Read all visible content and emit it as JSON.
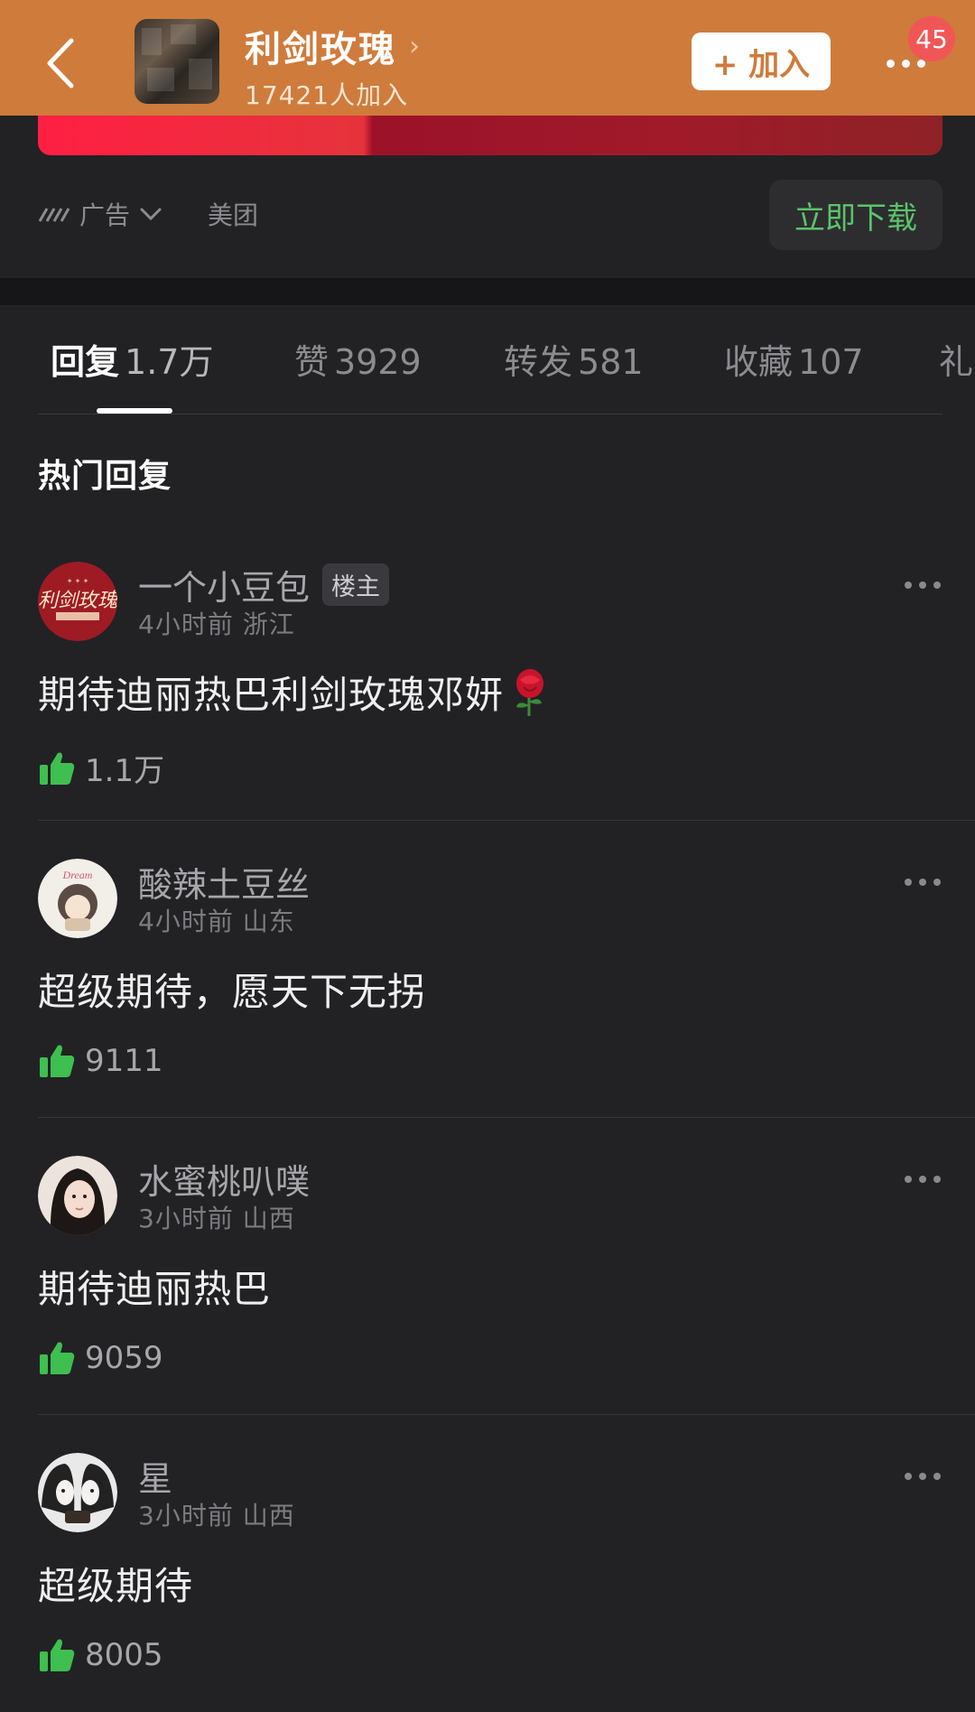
{
  "header": {
    "group_name": "利剑玫瑰",
    "member_count": "17421人加入",
    "join_label": "+ 加入",
    "notification_badge": "45",
    "bg_color": "#cf7b3b"
  },
  "ad": {
    "tag_label": "广告",
    "advertiser": "美团",
    "download_label": "立即下载"
  },
  "tabs": [
    {
      "label": "回复",
      "count": "1.7万",
      "active": true
    },
    {
      "label": "赞",
      "count": "3929"
    },
    {
      "label": "转发",
      "count": "581"
    },
    {
      "label": "收藏",
      "count": "107"
    },
    {
      "label": "礼",
      "count": ""
    }
  ],
  "section_title": "热门回复",
  "comments": [
    {
      "name": "一个小豆包",
      "tag": "楼主",
      "time": "4小时前",
      "location": "浙江",
      "content": "期待迪丽热巴利剑玫瑰邓妍",
      "emoji": "rose-icon",
      "likes": "1.1万"
    },
    {
      "name": "酸辣土豆丝",
      "time": "4小时前",
      "location": "山东",
      "content": "超级期待，愿天下无拐",
      "likes": "9111"
    },
    {
      "name": "水蜜桃叭噗",
      "time": "3小时前",
      "location": "山西",
      "content": "期待迪丽热巴",
      "likes": "9059"
    },
    {
      "name": "星",
      "time": "3小时前",
      "location": "山西",
      "content": "超级期待",
      "likes": "8005"
    }
  ],
  "colors": {
    "like_green": "#3fbf4f",
    "download_green": "#5cc36a",
    "badge_red": "#f15656",
    "background": "#222225"
  }
}
